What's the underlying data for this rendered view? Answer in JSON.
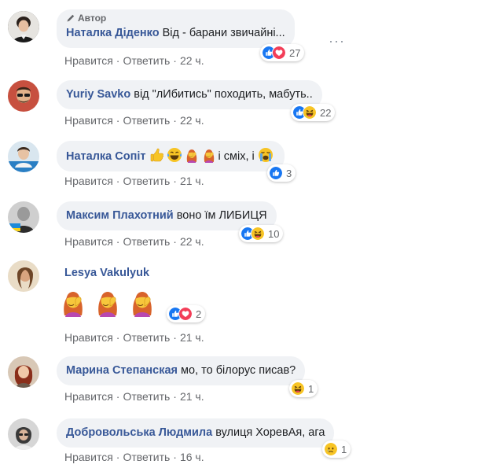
{
  "comments": [
    {
      "badge": "Автор",
      "author": "Наталка Діденко",
      "text": "Від - барани звичайні...",
      "actions": {
        "like": "Нравится",
        "reply": "Ответить",
        "time": "22 ч."
      },
      "reactions": {
        "icons": [
          "like",
          "love"
        ],
        "count": "27"
      }
    },
    {
      "author": "Yuriy Savko",
      "text": "від \"лИбитись\" походить, мабуть..",
      "actions": {
        "like": "Нравится",
        "reply": "Ответить",
        "time": "22 ч."
      },
      "reactions": {
        "icons": [
          "like",
          "haha"
        ],
        "count": "22"
      }
    },
    {
      "author": "Наталка Сопіт",
      "text_parts": [
        "і сміх, і"
      ],
      "emoji_inline": [
        "pointing-hand-emoji",
        "tears-of-joy-emoji",
        "facepalm-woman-emoji",
        "facepalm-woman-emoji",
        "crying-face-emoji"
      ],
      "actions": {
        "like": "Нравится",
        "reply": "Ответить",
        "time": "21 ч."
      },
      "reactions": {
        "icons": [
          "like"
        ],
        "count": "3"
      }
    },
    {
      "author": "Максим Плахотний",
      "text": "воно їм ЛИБИЦЯ",
      "actions": {
        "like": "Нравится",
        "reply": "Ответить",
        "time": "22 ч."
      },
      "reactions": {
        "icons": [
          "like",
          "haha"
        ],
        "count": "10"
      }
    },
    {
      "author": "Lesya Vakulyuk",
      "emoji_large": [
        "facepalm-woman-emoji",
        "facepalm-woman-emoji",
        "facepalm-woman-emoji"
      ],
      "actions": {
        "like": "Нравится",
        "reply": "Ответить",
        "time": "21 ч."
      },
      "reactions": {
        "icons": [
          "like",
          "love"
        ],
        "count": "2"
      }
    },
    {
      "author": "Марина Степанская",
      "text": "мо, то білорус писав?",
      "actions": {
        "like": "Нравится",
        "reply": "Ответить",
        "time": "21 ч."
      },
      "reactions": {
        "icons": [
          "haha"
        ],
        "count": "1"
      }
    },
    {
      "author": "Добровольська Людмила",
      "text": "вулиця ХоревАя, ага",
      "actions": {
        "like": "Нравится",
        "reply": "Ответить",
        "time": "16 ч."
      },
      "reactions": {
        "icons": [
          "sad"
        ],
        "count": "1"
      }
    }
  ],
  "separator": "·",
  "more_label": "···",
  "colors": {
    "author_link": "#385898",
    "bubble_bg": "#f0f2f5",
    "meta_text": "#65676b",
    "like": "#1877f2",
    "love": "#f33e58",
    "haha": "#f7b125"
  }
}
